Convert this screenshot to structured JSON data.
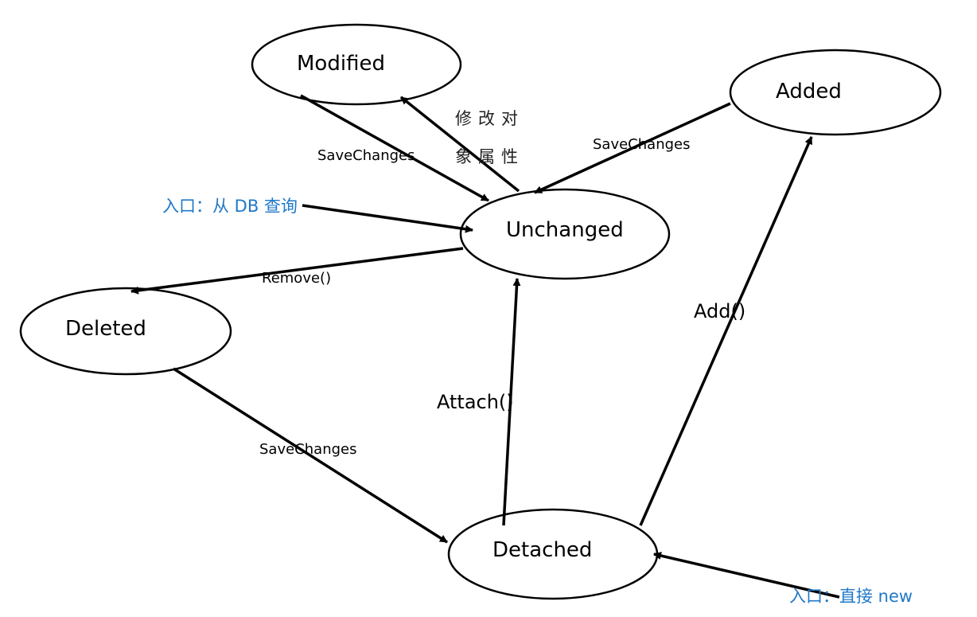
{
  "states": {
    "modified": "Modified",
    "added": "Added",
    "unchanged": "Unchanged",
    "deleted": "Deleted",
    "detached": "Detached"
  },
  "transitions": {
    "modified_to_unchanged": "SaveChanges",
    "modify_props_line1": "修改对",
    "modify_props_line2": "象属性",
    "added_to_unchanged": "SaveChanges",
    "remove": "Remove()",
    "deleted_to_detached": "SaveChanges",
    "attach": "Attach()",
    "add": "Add()"
  },
  "entries": {
    "from_db": "入口：从 DB 查询",
    "new": "入口：直接 new"
  },
  "colors": {
    "line": "#000000",
    "entry_text": "#1f78c8"
  }
}
